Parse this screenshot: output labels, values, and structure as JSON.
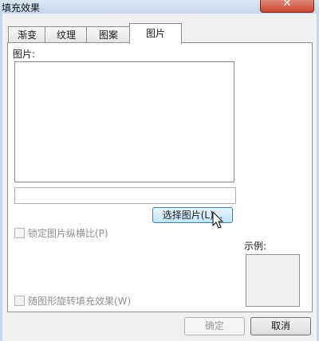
{
  "window": {
    "title": "填充效果",
    "close_glyph": "✕"
  },
  "tabs": [
    {
      "label": "渐变",
      "active": false
    },
    {
      "label": "纹理",
      "active": false
    },
    {
      "label": "图案",
      "active": false
    },
    {
      "label": "图片",
      "active": true
    }
  ],
  "picture_tab": {
    "picture_label": "图片:",
    "filename_value": "",
    "select_button": "选择图片(L)...",
    "lock_aspect_label": "锁定图片纵横比(P)",
    "rotate_label": "随图形旋转填充效果(W)",
    "sample_label": "示例:"
  },
  "buttons": {
    "ok": "确定",
    "cancel": "取消"
  },
  "icons": {
    "cursor": "mouse-pointer-icon"
  },
  "colors": {
    "panel": "#ffffff",
    "dialog": "#f0f0f0",
    "button_hover": "#bee6fd"
  }
}
